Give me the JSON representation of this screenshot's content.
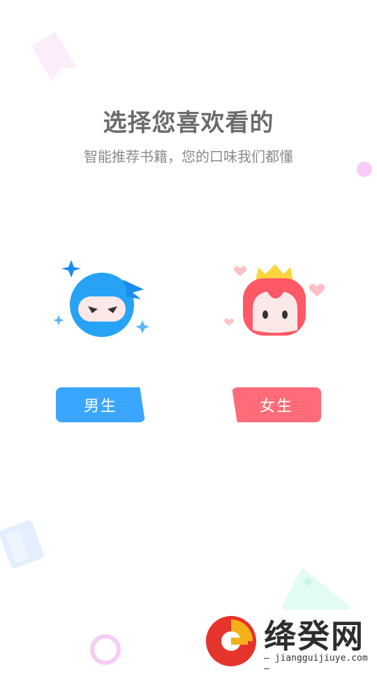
{
  "header": {
    "title": "选择您喜欢看的",
    "subtitle": "智能推荐书籍，您的口味我们都懂"
  },
  "options": [
    {
      "label": "男生",
      "color": "#3aa6ff",
      "icon": "ninja-avatar-icon"
    },
    {
      "label": "女生",
      "color": "#ff6b78",
      "icon": "princess-avatar-icon"
    }
  ],
  "watermark": {
    "text": "绛癸网",
    "url": "jiangguijiuye.com"
  },
  "colors": {
    "title": "#6b6b6b",
    "subtitle": "#8a8a8a",
    "male": "#3aa6ff",
    "female": "#ff6b78"
  }
}
